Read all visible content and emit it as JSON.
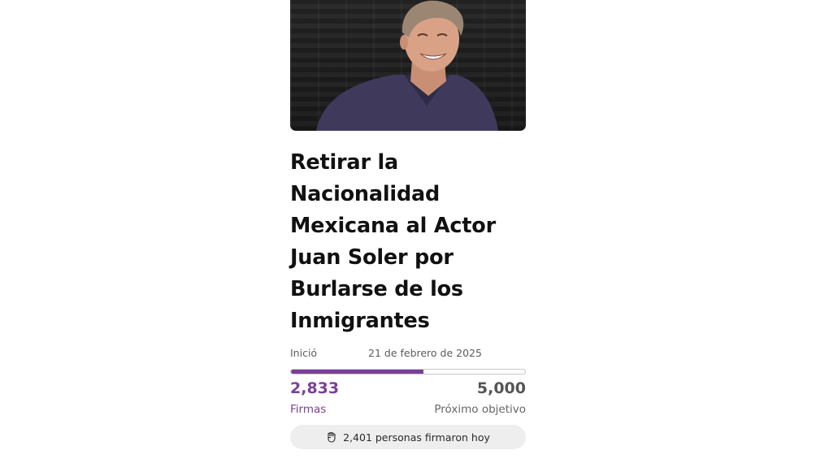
{
  "petition": {
    "title": "Retirar la Nacionalidad Mexicana al Actor Juan Soler por Burlarse de los Inmigrantes",
    "started_label": "Inició",
    "started_date": "21 de febrero de 2025",
    "signatures": "2,833",
    "signatures_label": "Firmas",
    "goal": "5,000",
    "goal_label": "Próximo objetivo",
    "progress_fraction": 0.567,
    "today_text": "2,401 personas firmaron hoy",
    "today_icon": "raised-fist-icon"
  },
  "colors": {
    "accent": "#7b3f98",
    "pill_bg": "#eeeeee"
  }
}
